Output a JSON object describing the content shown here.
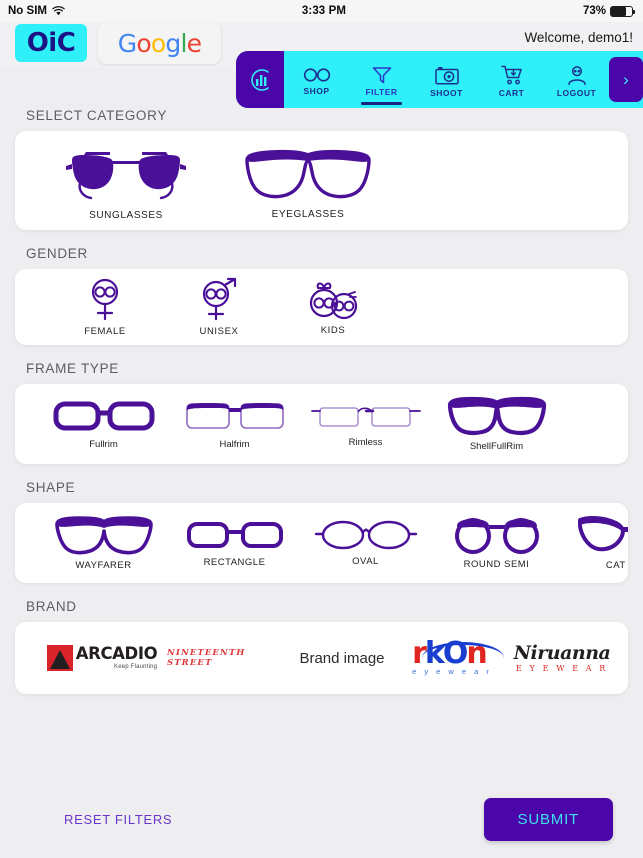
{
  "status_bar": {
    "carrier": "No SIM",
    "wifi_icon": "wifi-icon",
    "time": "3:33 PM",
    "battery_percent": "73%",
    "battery_level": 73
  },
  "header": {
    "app_logo_text": "OiC",
    "google_logo_text": "Google",
    "google_letters": [
      "G",
      "o",
      "o",
      "g",
      "l",
      "e"
    ],
    "welcome_text": "Welcome, demo1!"
  },
  "nav": {
    "brand_icon": "circle-bars-logo-icon",
    "items": [
      {
        "label": "SHOP",
        "icon": "glasses-icon",
        "active": false
      },
      {
        "label": "FILTER",
        "icon": "funnel-icon",
        "active": true
      },
      {
        "label": "SHOOT",
        "icon": "camera-icon",
        "active": false
      },
      {
        "label": "CART",
        "icon": "cart-icon",
        "active": false
      },
      {
        "label": "LOGOUT",
        "icon": "user-icon",
        "active": false
      }
    ],
    "next_label": "›",
    "bg_color": "#2FF0F8",
    "accent_color": "#4A06A8"
  },
  "sections": {
    "category": {
      "title": "SELECT CATEGORY",
      "options": [
        {
          "label": "SUNGLASSES",
          "icon": "aviator-sunglasses-icon"
        },
        {
          "label": "EYEGLASSES",
          "icon": "eyeglasses-icon"
        }
      ]
    },
    "gender": {
      "title": "GENDER",
      "options": [
        {
          "label": "FEMALE",
          "icon": "female-symbol-glasses-icon"
        },
        {
          "label": "UNISEX",
          "icon": "unisex-symbol-glasses-icon"
        },
        {
          "label": "KIDS",
          "icon": "kids-faces-glasses-icon"
        }
      ]
    },
    "frame_type": {
      "title": "FRAME TYPE",
      "options": [
        {
          "label": "Fullrim",
          "icon": "fullrim-frame-icon"
        },
        {
          "label": "Halfrim",
          "icon": "halfrim-frame-icon"
        },
        {
          "label": "Rimless",
          "icon": "rimless-frame-icon"
        },
        {
          "label": "ShellFullRim",
          "icon": "shellfullrim-frame-icon"
        }
      ]
    },
    "shape": {
      "title": "SHAPE",
      "options": [
        {
          "label": "WAYFARER",
          "icon": "wayfarer-shape-icon"
        },
        {
          "label": "RECTANGLE",
          "icon": "rectangle-shape-icon"
        },
        {
          "label": "OVAL",
          "icon": "oval-shape-icon"
        },
        {
          "label": "ROUND SEMI",
          "icon": "round-semi-shape-icon"
        },
        {
          "label": "CAT EYE",
          "icon": "cat-eye-shape-icon"
        }
      ]
    },
    "brand": {
      "title": "BRAND",
      "items": [
        {
          "name": "ARCADIO",
          "tagline": "Keep Flaunting"
        },
        {
          "name": "NINETEENTH STREET"
        },
        {
          "name": "Brand image"
        },
        {
          "name": "IKON",
          "tagline": "e y e w e a r"
        },
        {
          "name": "Niruanna",
          "tagline": "E Y E W E A R"
        }
      ]
    }
  },
  "footer": {
    "reset_label": "RESET FILTERS",
    "submit_label": "SUBMIT"
  },
  "colors": {
    "purple": "#4A06A8",
    "cyan": "#2FF0F8",
    "page_bg": "#EEEEF1"
  }
}
